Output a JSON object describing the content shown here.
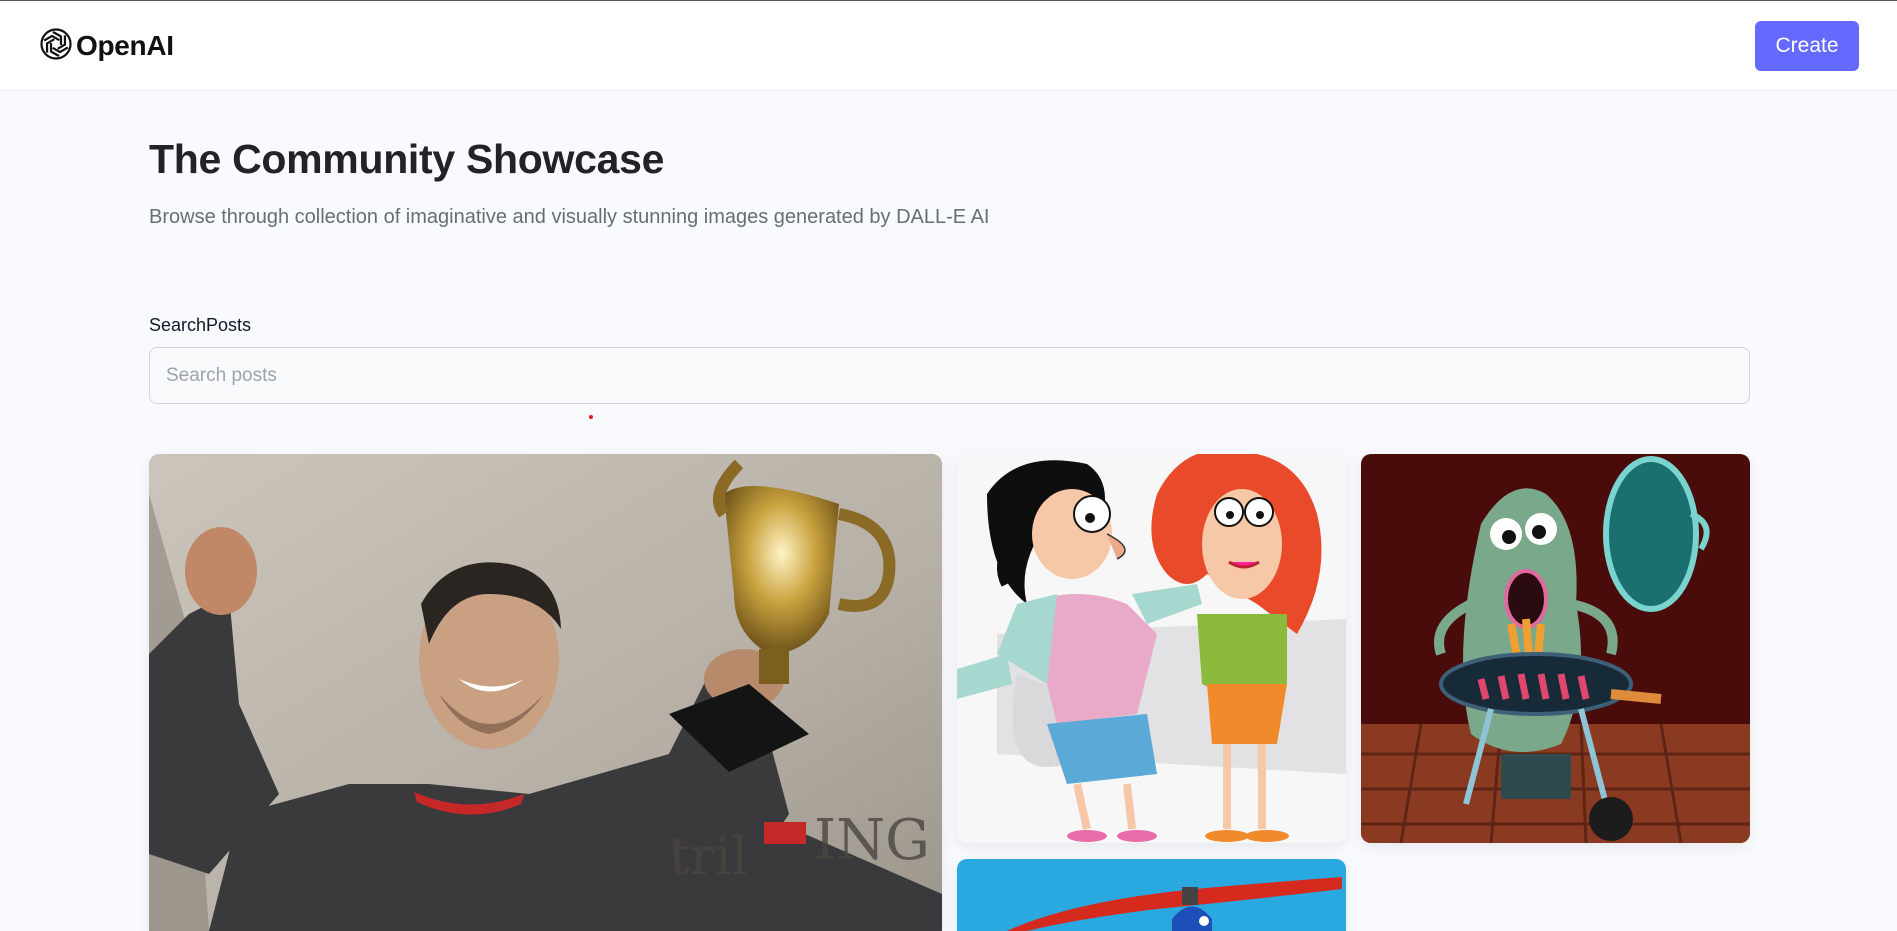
{
  "header": {
    "logo_text": "OpenAI",
    "logo_icon": "openai-logo-icon",
    "create_label": "Create"
  },
  "main": {
    "title": "The Community Showcase",
    "subtitle": "Browse through collection of imaginative and visually stunning images generated by DALL-E AI"
  },
  "search": {
    "label": "SearchPosts",
    "placeholder": "Search posts",
    "value": ""
  },
  "gallery": {
    "cards": [
      {
        "name": "trophy-man-image",
        "overlay_text": "ING"
      },
      {
        "name": "cartoon-women-image"
      },
      {
        "name": "pickle-grill-image"
      },
      {
        "name": "cartoon-helicopter-image"
      }
    ]
  },
  "colors": {
    "accent": "#6469ff",
    "page_bg": "#f9fafe",
    "title": "#222328",
    "subtitle": "#666e75"
  }
}
